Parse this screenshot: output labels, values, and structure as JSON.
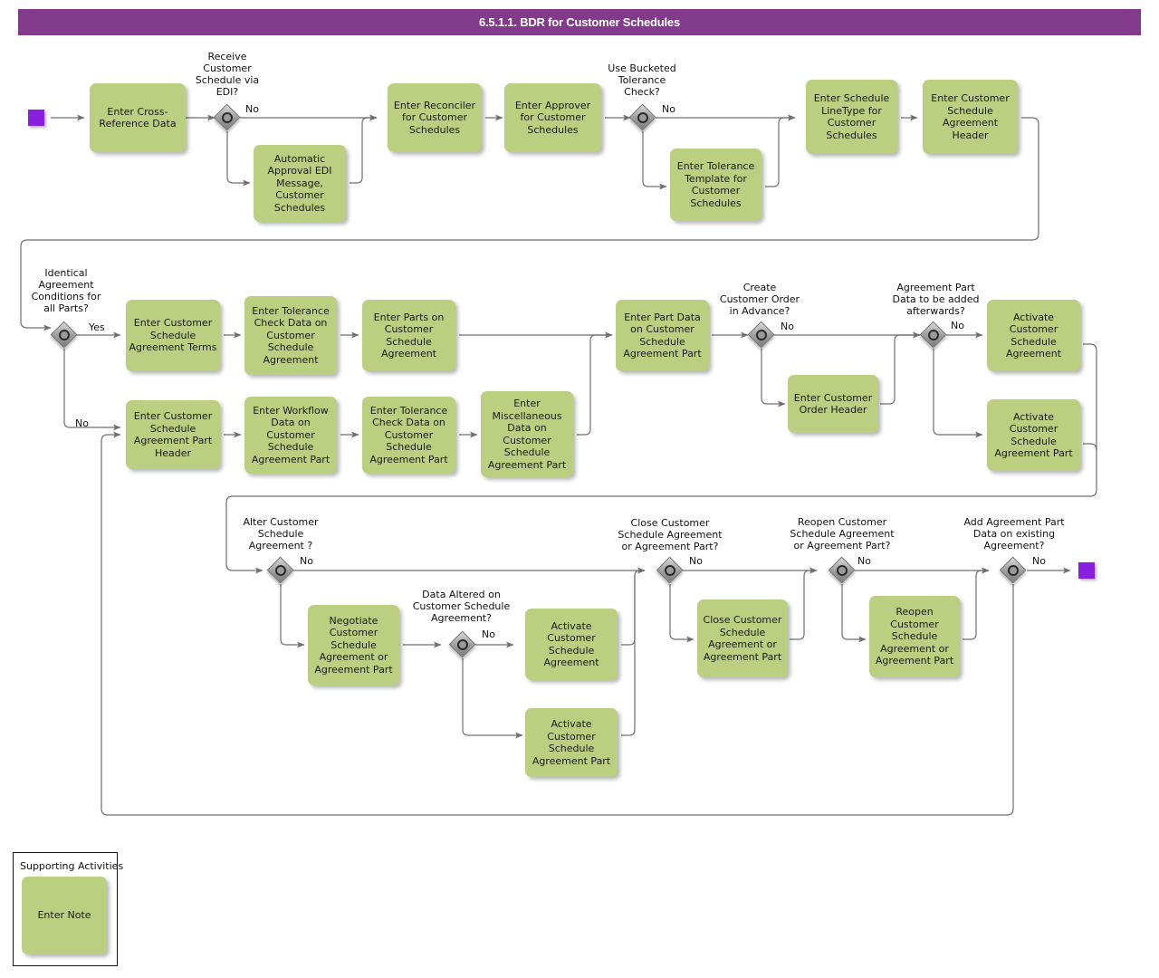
{
  "header": {
    "title": "6.5.1.1. BDR for Customer Schedules",
    "bar_color": "#823B8A"
  },
  "palette": {
    "task_fill": "#BCCF81",
    "event_fill": "#8B1FE0",
    "gateway_fill": "#9C9C9C",
    "connector": "#6E6E6E"
  },
  "events": [
    {
      "name": "start-event",
      "label": ""
    },
    {
      "name": "end-event",
      "label": ""
    }
  ],
  "tasks": [
    {
      "id": "t1",
      "label": "Enter Cross-\nReference Data"
    },
    {
      "id": "t2",
      "label": "Automatic\nApproval EDI\nMessage,\nCustomer\nSchedules"
    },
    {
      "id": "t3",
      "label": "Enter Reconciler\nfor Customer\nSchedules"
    },
    {
      "id": "t4",
      "label": "Enter Approver\nfor Customer\nSchedules"
    },
    {
      "id": "t5",
      "label": "Enter Tolerance\nTemplate for\nCustomer\nSchedules"
    },
    {
      "id": "t6",
      "label": "Enter Schedule\nLineType for\nCustomer\nSchedules"
    },
    {
      "id": "t7",
      "label": "Enter Customer\nSchedule\nAgreement\nHeader"
    },
    {
      "id": "t8",
      "label": "Enter Customer\nSchedule\nAgreement\nTerms"
    },
    {
      "id": "t9",
      "label": "Enter Tolerance\nCheck Data on\nCustomer\nSchedule\nAgreement"
    },
    {
      "id": "t10",
      "label": "Enter Parts on\nCustomer\nSchedule\nAgreement"
    },
    {
      "id": "t11",
      "label": "Enter Customer\nSchedule\nAgreement Part\nHeader"
    },
    {
      "id": "t12",
      "label": "Enter Workflow\nData on\nCustomer\nSchedule\nAgreement Part"
    },
    {
      "id": "t13",
      "label": "Enter Tolerance\nCheck Data on\nCustomer\nSchedule\nAgreement Part"
    },
    {
      "id": "t14",
      "label": "Enter\nMiscellaneous\nData on\nCustomer\nSchedule\nAgreement Part"
    },
    {
      "id": "t15",
      "label": "Enter Part Data\non Customer\nSchedule\nAgreement Part"
    },
    {
      "id": "t16",
      "label": "Enter Customer\nOrder Header"
    },
    {
      "id": "t17",
      "label": "Activate\nCustomer\nSchedule\nAgreement"
    },
    {
      "id": "t18",
      "label": "Activate\nCustomer\nSchedule\nAgreement Part"
    },
    {
      "id": "t19",
      "label": "Negotiate\nCustomer\nSchedule\nAgreement or\nAgreement Part"
    },
    {
      "id": "t20",
      "label": "Activate\nCustomer\nSchedule\nAgreement"
    },
    {
      "id": "t21",
      "label": "Activate\nCustomer\nSchedule\nAgreement Part"
    },
    {
      "id": "t22",
      "label": "Close Customer\nSchedule\nAgreement or\nAgreement Part"
    },
    {
      "id": "t23",
      "label": "Reopen\nCustomer\nSchedule\nAgreement or\nAgreement Part"
    },
    {
      "id": "t24",
      "label": "Enter Note"
    }
  ],
  "gateways": [
    {
      "id": "g1",
      "label": "Receive\nCustomer\nSchedule via\nEDI?",
      "branch": "No"
    },
    {
      "id": "g2",
      "label": "Use Bucketed\nTolerance\nCheck?",
      "branch": "No"
    },
    {
      "id": "g3",
      "label": "Identical\nAgreement\nConditions for\nall Parts?",
      "branch": "Yes",
      "branch2": "No"
    },
    {
      "id": "g4",
      "label": "Create\nCustomer Order\nin Advance?",
      "branch": "No"
    },
    {
      "id": "g5",
      "label": "Agreement Part\nData to be added\nafterwards?",
      "branch": "No"
    },
    {
      "id": "g6",
      "label": "Alter Customer\nSchedule\nAgreement ?",
      "branch": "No"
    },
    {
      "id": "g7",
      "label": "Data Altered on\nCustomer Schedule\nAgreement?",
      "branch": "No"
    },
    {
      "id": "g8",
      "label": "Close Customer\nSchedule Agreement\nor Agreement Part?",
      "branch": "No"
    },
    {
      "id": "g9",
      "label": "Reopen Customer\nSchedule Agreement\nor Agreement Part?",
      "branch": "No"
    },
    {
      "id": "g10",
      "label": "Add Agreement Part\nData on existing\nAgreement?",
      "branch": "No"
    }
  ],
  "pool": {
    "title": "Supporting Activities"
  },
  "chart_data": {
    "type": "diagram",
    "title": "6.5.1.1. BDR for Customer Schedules",
    "notation": "BPMN business-driven requirement flow"
  }
}
